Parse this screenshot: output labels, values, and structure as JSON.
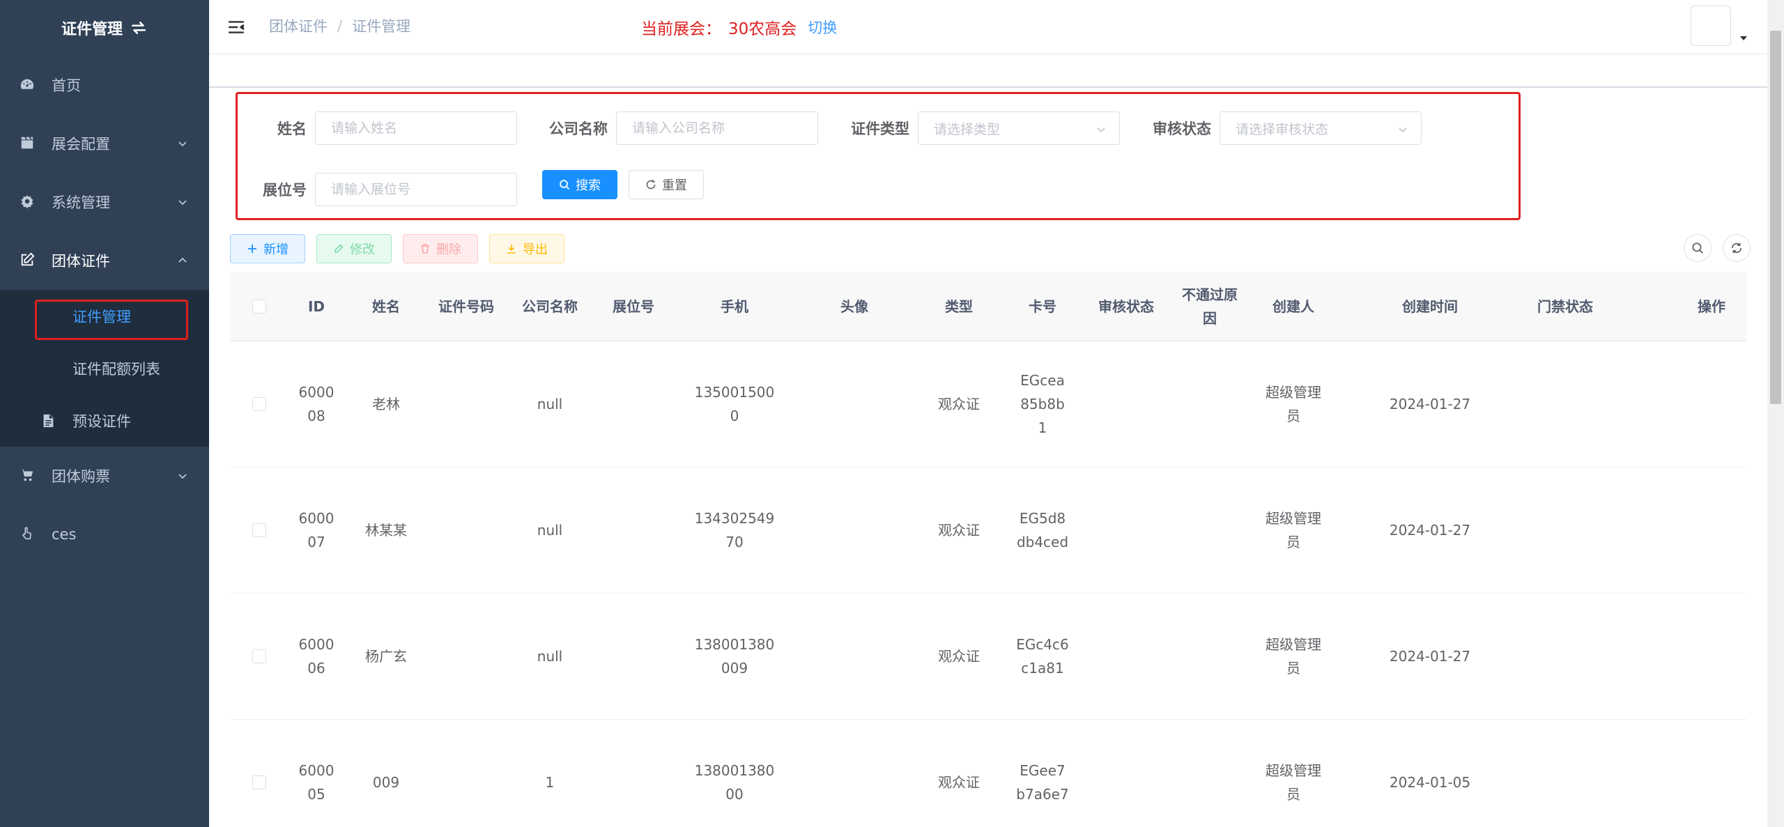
{
  "sidebar": {
    "logo_title": "证件管理",
    "items": [
      {
        "label": "首页"
      },
      {
        "label": "展会配置"
      },
      {
        "label": "系统管理"
      },
      {
        "label": "团体证件"
      },
      {
        "label": "团体购票"
      },
      {
        "label": "ces"
      }
    ],
    "sub_items": [
      {
        "label": "证件管理"
      },
      {
        "label": "证件配额列表"
      },
      {
        "label": "预设证件"
      }
    ]
  },
  "header": {
    "breadcrumb": [
      "团体证件",
      "证件管理"
    ],
    "current_expo_label": "当前展会：",
    "current_expo_value": "30农高会",
    "switch_label": "切换"
  },
  "search": {
    "name_label": "姓名",
    "name_placeholder": "请输入姓名",
    "company_label": "公司名称",
    "company_placeholder": "请输入公司名称",
    "type_label": "证件类型",
    "type_placeholder": "请选择类型",
    "status_label": "审核状态",
    "status_placeholder": "请选择审核状态",
    "booth_label": "展位号",
    "booth_placeholder": "请输入展位号",
    "search_button": "搜索",
    "reset_button": "重置"
  },
  "toolbar": {
    "add": "新增",
    "edit": "修改",
    "delete": "删除",
    "export": "导出"
  },
  "table": {
    "columns": [
      "ID",
      "姓名",
      "证件号码",
      "公司名称",
      "展位号",
      "手机",
      "头像",
      "类型",
      "卡号",
      "审核状态",
      "不通过原因",
      "创建人",
      "创建时间",
      "门禁状态",
      "操作"
    ],
    "rows": [
      {
        "id": "600008",
        "name": "老林",
        "cert_no": "",
        "company": "null",
        "booth": "",
        "phone": "1350015000",
        "avatar": "",
        "type": "观众证",
        "card": "EGcea85b8b1",
        "status": "",
        "reason": "",
        "creator": "超级管理员",
        "created": "2024-01-27",
        "access": "",
        "ops": ""
      },
      {
        "id": "600007",
        "name": "林某某",
        "cert_no": "",
        "company": "null",
        "booth": "",
        "phone": "13430254970",
        "avatar": "",
        "type": "观众证",
        "card": "EG5d8db4ced",
        "status": "",
        "reason": "",
        "creator": "超级管理员",
        "created": "2024-01-27",
        "access": "",
        "ops": ""
      },
      {
        "id": "600006",
        "name": "杨广玄",
        "cert_no": "",
        "company": "null",
        "booth": "",
        "phone": "138001380009",
        "avatar": "",
        "type": "观众证",
        "card": "EGc4c6c1a81",
        "status": "",
        "reason": "",
        "creator": "超级管理员",
        "created": "2024-01-27",
        "access": "",
        "ops": ""
      },
      {
        "id": "600005",
        "name": "009",
        "cert_no": "",
        "company": "1",
        "booth": "",
        "phone": "13800138000",
        "avatar": "",
        "type": "观众证",
        "card": "EGee7b7a6e7",
        "status": "",
        "reason": "",
        "creator": "超级管理员",
        "created": "2024-01-05",
        "access": "",
        "ops": ""
      }
    ]
  },
  "colors": {
    "sidebar_bg": "#304156",
    "submenu_bg": "#1f2d3d",
    "primary": "#1890ff",
    "highlight_red": "#e02020"
  }
}
